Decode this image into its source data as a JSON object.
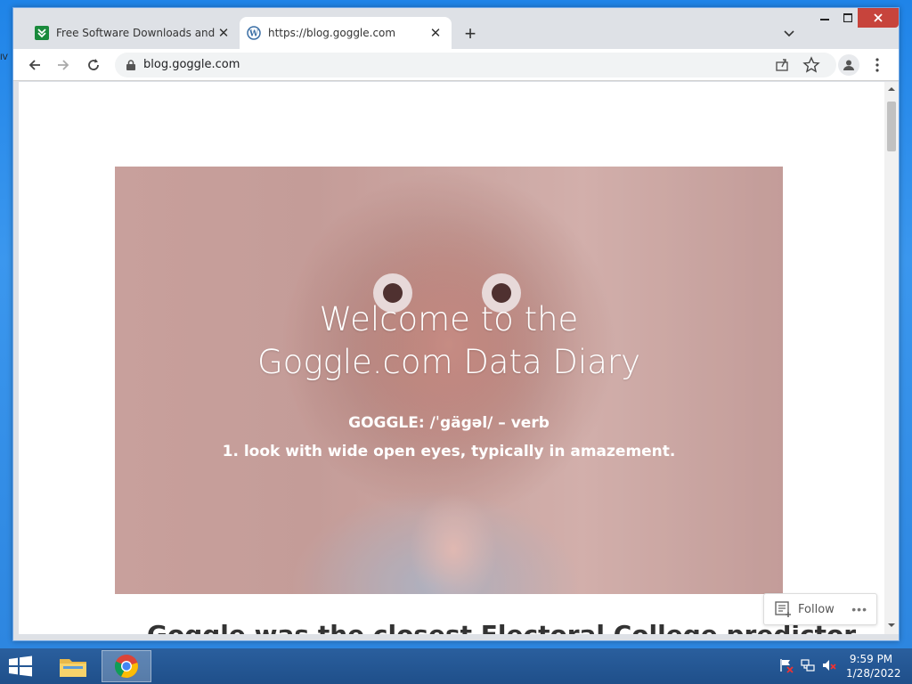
{
  "desktop": {
    "edge_label": "IV"
  },
  "browser": {
    "tabs": [
      {
        "title": "Free Software Downloads and Re",
        "icon": "softpedia-favicon",
        "active": false
      },
      {
        "title": "https://blog.goggle.com",
        "icon": "wordpress-favicon",
        "active": true
      }
    ],
    "address": "blog.goggle.com"
  },
  "page": {
    "hero_title_line1": "Welcome to the",
    "hero_title_line2": "Goggle.com Data Diary",
    "definition_line1": "GOGGLE: /ˈgägəl/ – verb",
    "definition_line2": "1. look with wide open eyes, typically in amazement.",
    "post_heading": "Goggle was the closest Electoral College predictor",
    "follow_label": "Follow",
    "more_label": "•••"
  },
  "taskbar": {
    "time": "9:59 PM",
    "date": "1/28/2022"
  },
  "colors": {
    "close_button": "#c7443c",
    "taskbar": "#1f4f8a",
    "desktop": "#2d86e0"
  }
}
